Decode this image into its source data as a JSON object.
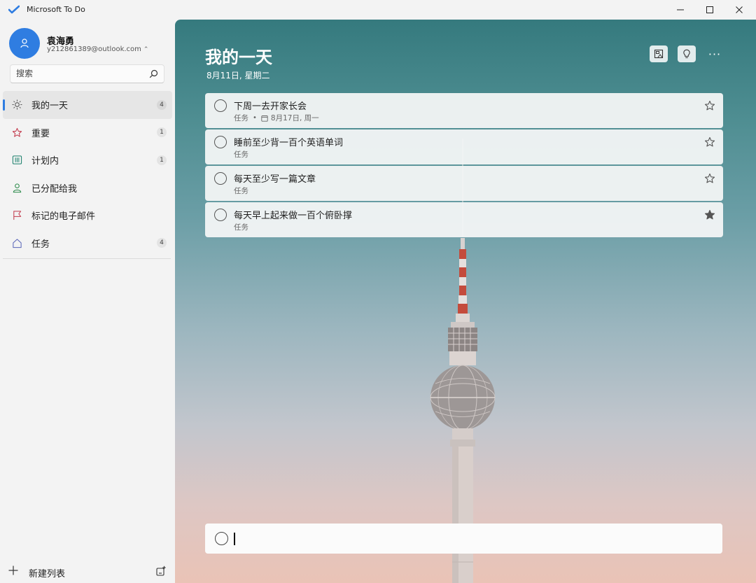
{
  "window": {
    "title": "Microsoft To Do",
    "icon": "todo-check-icon",
    "controls": [
      "minimize-icon",
      "maximize-icon",
      "close-icon"
    ]
  },
  "user": {
    "name": "袁海勇",
    "email": "y212861389@outlook.com",
    "avatar_color": "#2f7de1"
  },
  "search": {
    "placeholder": "搜索"
  },
  "sidebar": {
    "items": [
      {
        "label": "我的一天",
        "count": "4",
        "icon": "sun-icon",
        "icon_color": "#555555",
        "active": true
      },
      {
        "label": "重要",
        "count": "1",
        "icon": "star-outline-icon",
        "icon_color": "#c2394b",
        "active": false
      },
      {
        "label": "计划内",
        "count": "1",
        "icon": "calendar-grid-icon",
        "icon_color": "#1a7f6b",
        "active": false
      },
      {
        "label": "已分配给我",
        "count": "",
        "icon": "person-icon",
        "icon_color": "#2b8a4a",
        "active": false
      },
      {
        "label": "标记的电子邮件",
        "count": "",
        "icon": "flag-icon",
        "icon_color": "#c2394b",
        "active": false
      },
      {
        "label": "任务",
        "count": "4",
        "icon": "home-icon",
        "icon_color": "#5a66b8",
        "active": false
      }
    ],
    "new_list_label": "新建列表"
  },
  "main": {
    "title": "我的一天",
    "date": "8月11日, 星期二",
    "tasks": [
      {
        "title": "下周一去开家长会",
        "list": "任务",
        "due": "8月17日, 周一",
        "starred": false
      },
      {
        "title": "睡前至少背一百个英语单词",
        "list": "任务",
        "due": "",
        "starred": false
      },
      {
        "title": "每天至少写一篇文章",
        "list": "任务",
        "due": "",
        "starred": false
      },
      {
        "title": "每天早上起来做一百个俯卧撑",
        "list": "任务",
        "due": "",
        "starred": true
      }
    ],
    "add_task_value": ""
  },
  "colors": {
    "accent": "#2f7de1",
    "background_top": "#357a7e",
    "background_bottom": "#eac3b6"
  }
}
